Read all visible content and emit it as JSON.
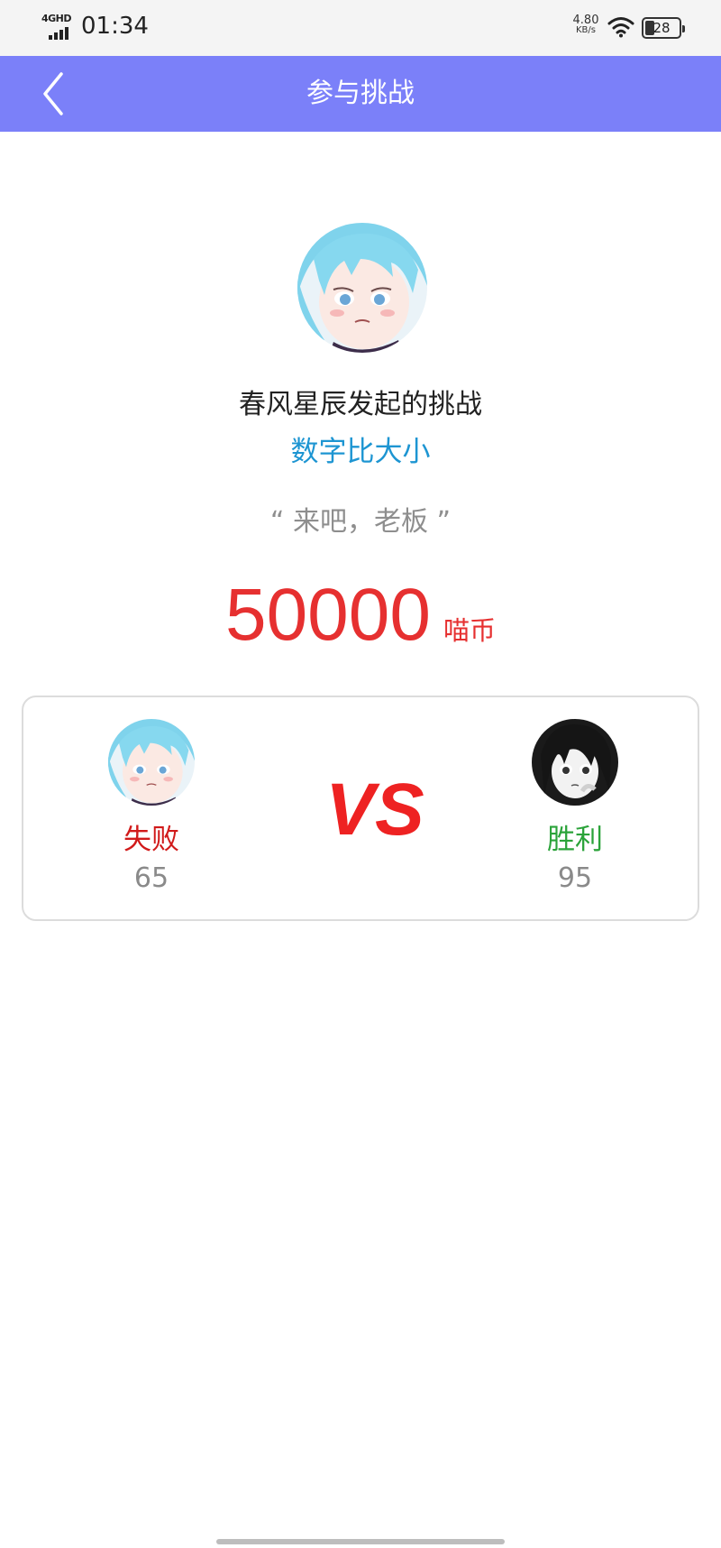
{
  "status_bar": {
    "network": "4GHD",
    "time": "01:34",
    "speed_value": "4.80",
    "speed_unit": "KB/s",
    "battery": "28"
  },
  "nav": {
    "title": "参与挑战",
    "back_icon": "chevron-left-icon"
  },
  "challenge": {
    "challenger_text": "春风星辰发起的挑战",
    "game_name": "数字比大小",
    "quote": "“ 来吧，老板 ”",
    "amount": "50000",
    "unit": "喵币"
  },
  "result": {
    "vs_label": "VS",
    "left": {
      "result": "失败",
      "score": "65"
    },
    "right": {
      "result": "胜利",
      "score": "95"
    }
  },
  "colors": {
    "nav_bg": "#7b80f9",
    "game_name": "#1d95d2",
    "amount": "#e63030",
    "lose": "#d11a1a",
    "win": "#2ba33a",
    "vs": "#ee2222"
  }
}
